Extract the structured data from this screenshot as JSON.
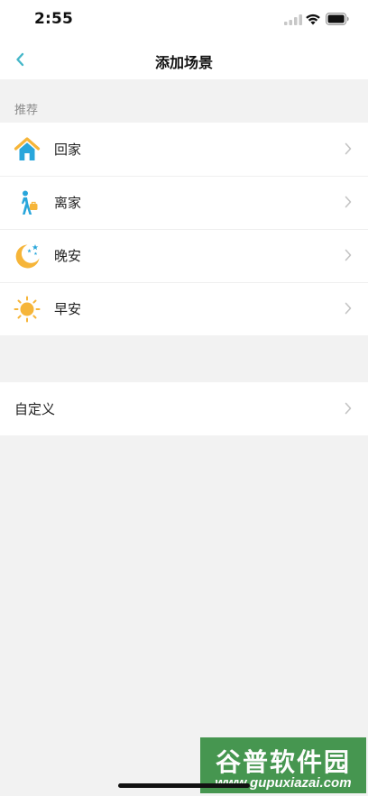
{
  "status_bar": {
    "time": "2:55"
  },
  "nav": {
    "title": "添加场景",
    "back_icon": "chevron-left-icon"
  },
  "recommend": {
    "header": "推荐",
    "items": [
      {
        "label": "回家",
        "icon": "home-icon"
      },
      {
        "label": "离家",
        "icon": "walking-person-icon"
      },
      {
        "label": "晚安",
        "icon": "moon-stars-icon"
      },
      {
        "label": "早安",
        "icon": "sun-icon"
      }
    ]
  },
  "custom": {
    "items": [
      {
        "label": "自定义"
      }
    ]
  },
  "watermark": {
    "title": "谷普软件园",
    "url": "www.gupuxiazai.com"
  },
  "colors": {
    "accent": "#45b7c9",
    "background": "#f2f2f2",
    "home_roof": "#f6b539",
    "home_body": "#29a6db",
    "person": "#29a6db",
    "moon": "#f6b539",
    "sun": "#f6b539"
  }
}
